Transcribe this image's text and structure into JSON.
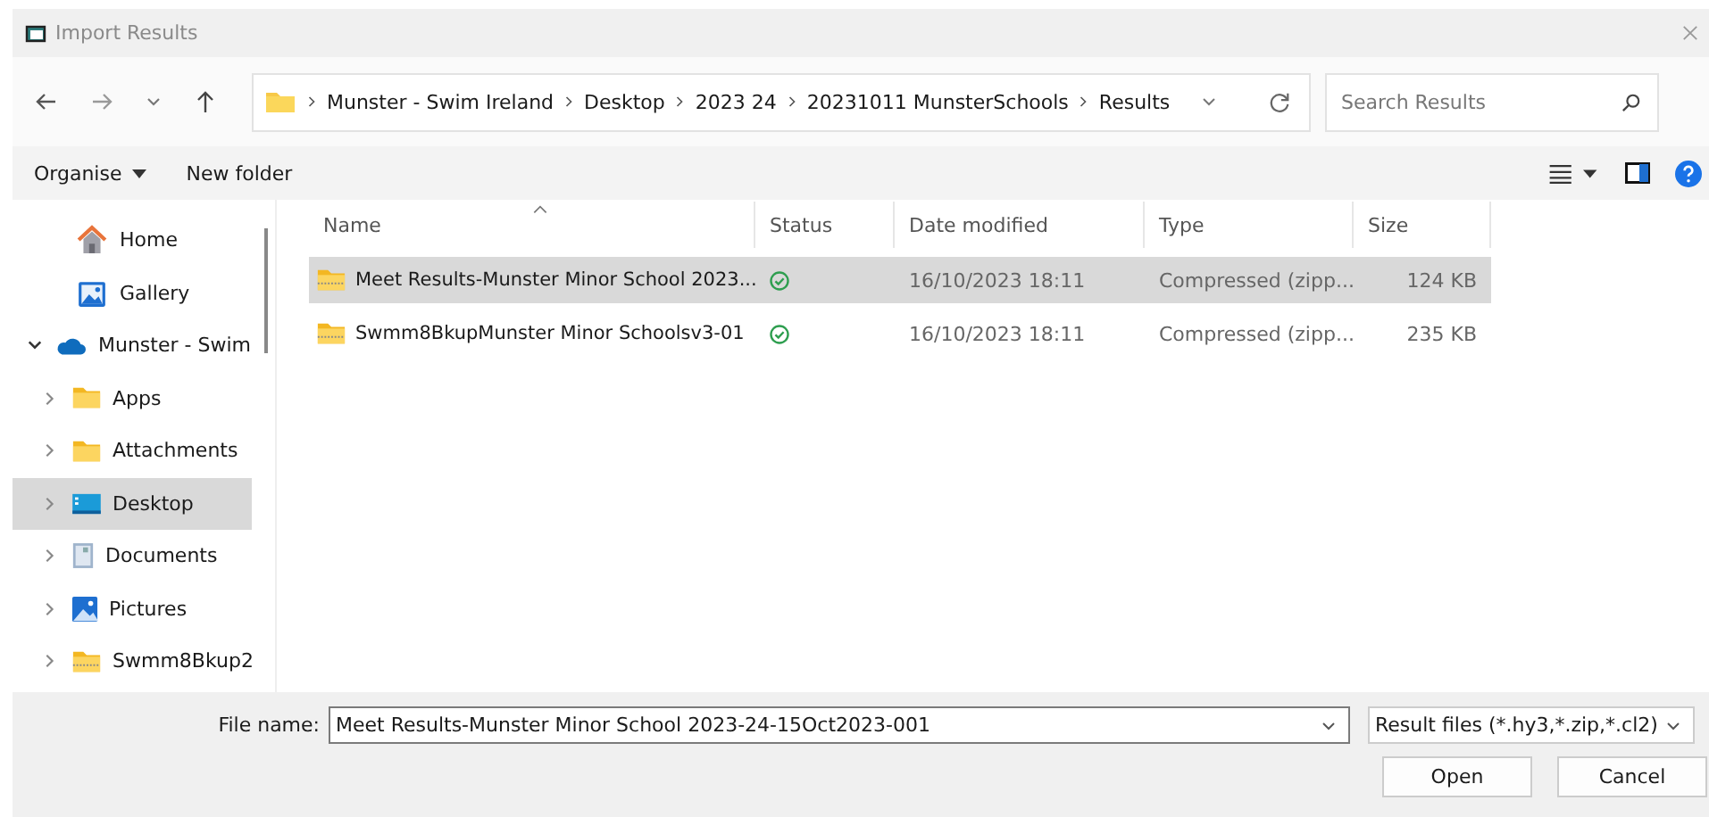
{
  "window": {
    "title": "Import Results"
  },
  "breadcrumb": [
    "Munster - Swim Ireland",
    "Desktop",
    "2023 24",
    "20231011 MunsterSchools",
    "Results"
  ],
  "search": {
    "placeholder": "Search Results"
  },
  "command_bar": {
    "organise": "Organise",
    "new_folder": "New folder"
  },
  "sidebar": {
    "items": [
      {
        "label": "Home",
        "kind": "home",
        "selected": false
      },
      {
        "label": "Gallery",
        "kind": "gallery",
        "selected": false
      },
      {
        "label": "Munster - Swim",
        "kind": "cloud",
        "selected": false,
        "expanded": true,
        "children": [
          {
            "label": "Apps",
            "kind": "folder",
            "selected": false,
            "expanded": false
          },
          {
            "label": "Attachments",
            "kind": "folder",
            "selected": false,
            "expanded": false
          },
          {
            "label": "Desktop",
            "kind": "desktop",
            "selected": true,
            "expanded": false
          },
          {
            "label": "Documents",
            "kind": "documents",
            "selected": false,
            "expanded": false
          },
          {
            "label": "Pictures",
            "kind": "pictures",
            "selected": false,
            "expanded": false
          },
          {
            "label": "Swmm8Bkup2",
            "kind": "zip",
            "selected": false,
            "expanded": false
          }
        ]
      }
    ]
  },
  "table": {
    "columns": [
      {
        "label": "Name",
        "sorted": true
      },
      {
        "label": "Status",
        "sorted": false
      },
      {
        "label": "Date modified",
        "sorted": false
      },
      {
        "label": "Type",
        "sorted": false
      },
      {
        "label": "Size",
        "sorted": false
      }
    ],
    "rows": [
      {
        "name": "Meet Results-Munster Minor School 2023...",
        "date": "16/10/2023 18:11",
        "type": "Compressed (zipp...",
        "size": "124 KB",
        "selected": true
      },
      {
        "name": "Swmm8BkupMunster Minor Schoolsv3-01",
        "date": "16/10/2023 18:11",
        "type": "Compressed (zipp...",
        "size": "235 KB",
        "selected": false
      }
    ]
  },
  "footer": {
    "file_name_label": "File name:",
    "file_name": "Meet Results-Munster Minor School 2023-24-15Oct2023-001",
    "filter": "Result files (*.hy3,*.zip,*.cl2)",
    "buttons": [
      "Open",
      "Cancel"
    ]
  }
}
